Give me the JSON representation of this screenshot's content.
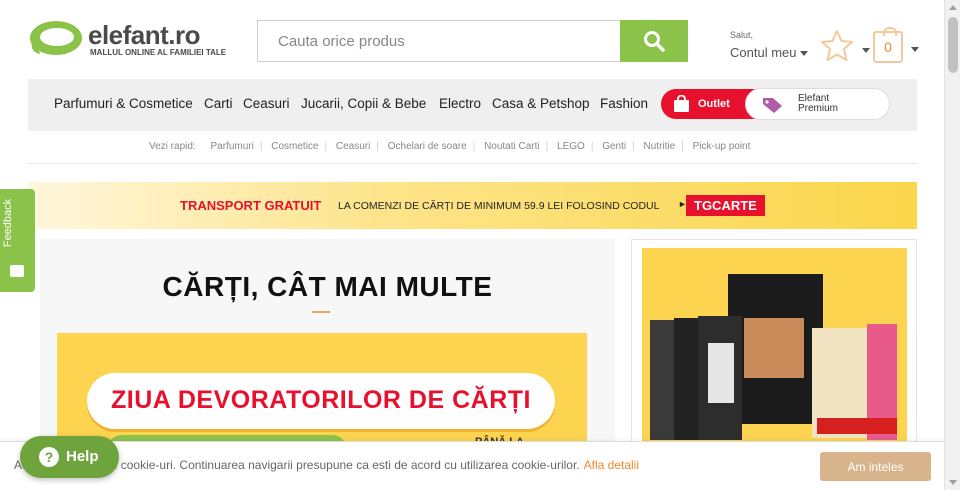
{
  "header": {
    "logo_text": "elefant.ro",
    "logo_tagline": "MALLUL ONLINE AL FAMILIEI TALE",
    "search_placeholder": "Cauta orice produs",
    "account_greeting": "Salut,",
    "account_label": "Contul meu",
    "cart_count": "0"
  },
  "nav": {
    "items": [
      "Parfumuri & Cosmetice",
      "Carti",
      "Ceasuri",
      "Jucarii, Copii & Bebe",
      "Electro",
      "Casa & Petshop",
      "Fashion"
    ],
    "outlet_label": "Outlet",
    "premium_label_1": "Elefant",
    "premium_label_2": "Premium"
  },
  "quick_links": {
    "label": "Vezi rapid:",
    "items": [
      "Parfumuri",
      "Cosmetice",
      "Ceasuri",
      "Ochelari de soare",
      "Noutati Carti",
      "LEGO",
      "Genti",
      "Nutritie",
      "Pick-up point"
    ]
  },
  "promo": {
    "headline": "TRANSPORT GRATUIT",
    "text": "LA COMENZI DE CĂRȚI DE MINIMUM 59.9 LEI FOLOSIND CODUL",
    "code": "TGCARTE"
  },
  "main": {
    "title": "CĂRȚI, CÂT MAI MULTE",
    "banner_text": "ZIUA DEVORATORILOR DE CĂRȚI",
    "banner_small": "PÂNĂ LA"
  },
  "feedback_label": "Feedback",
  "cookie": {
    "text": "Acest site foloseste cookie-uri. Continuarea navigarii presupune ca esti de acord cu utilizarea cookie-urilor.",
    "link": "Afla detalii",
    "accept": "Am inteles"
  },
  "help_label": "Help",
  "colors": {
    "brand_green": "#8bc34a",
    "red": "#e8112d",
    "orange": "#f08a2b",
    "yellow": "#fcd450"
  }
}
